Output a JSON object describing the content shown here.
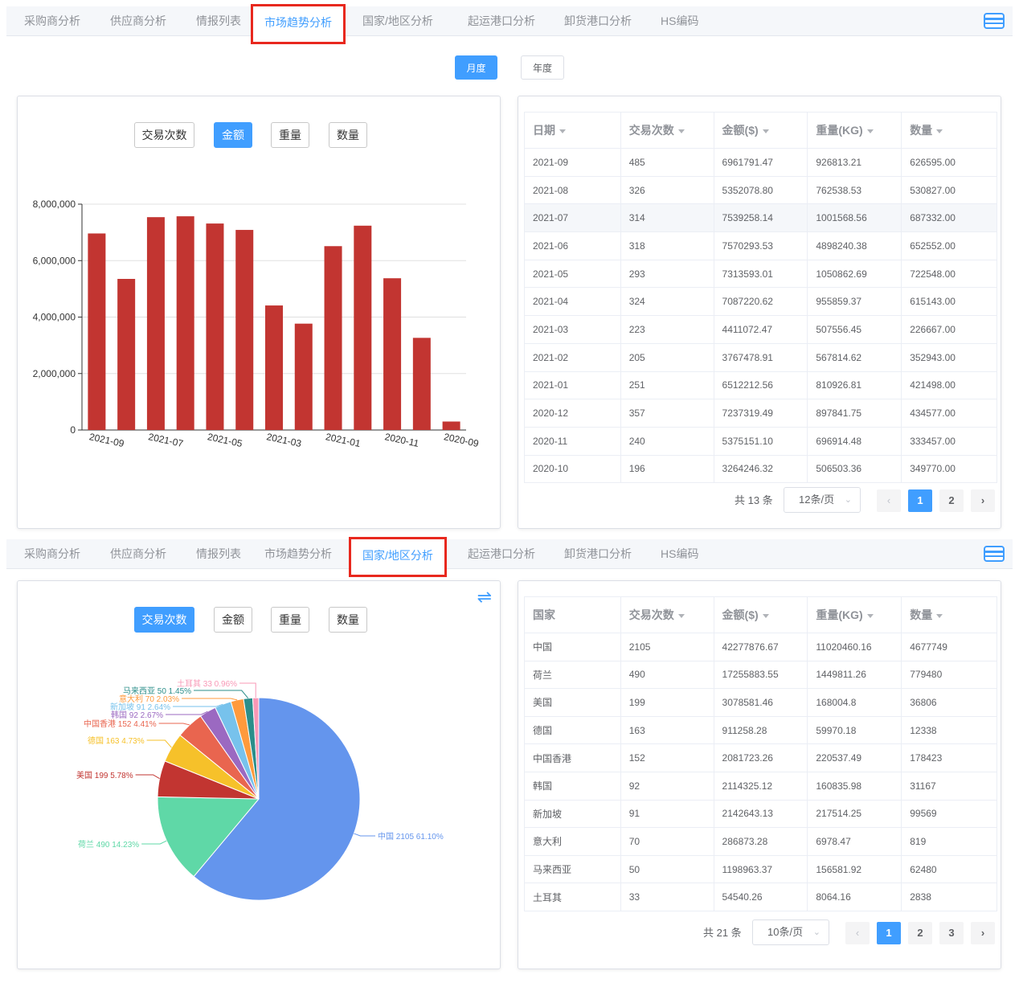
{
  "tabs": [
    "采购商分析",
    "供应商分析",
    "情报列表",
    "市场趋势分析",
    "国家/地区分析",
    "起运港口分析",
    "卸货港口分析",
    "HS编码"
  ],
  "top": {
    "active_tab_index": 3,
    "period_buttons": [
      "月度",
      "年度"
    ],
    "metric_buttons": [
      "交易次数",
      "金额",
      "重量",
      "数量"
    ],
    "active_metric_index": 1,
    "table": {
      "columns": [
        "日期",
        "交易次数",
        "金额($)",
        "重量(KG)",
        "数量"
      ],
      "rows": [
        [
          "2021-09",
          "485",
          "6961791.47",
          "926813.21",
          "626595.00"
        ],
        [
          "2021-08",
          "326",
          "5352078.80",
          "762538.53",
          "530827.00"
        ],
        [
          "2021-07",
          "314",
          "7539258.14",
          "1001568.56",
          "687332.00"
        ],
        [
          "2021-06",
          "318",
          "7570293.53",
          "4898240.38",
          "652552.00"
        ],
        [
          "2021-05",
          "293",
          "7313593.01",
          "1050862.69",
          "722548.00"
        ],
        [
          "2021-04",
          "324",
          "7087220.62",
          "955859.37",
          "615143.00"
        ],
        [
          "2021-03",
          "223",
          "4411072.47",
          "507556.45",
          "226667.00"
        ],
        [
          "2021-02",
          "205",
          "3767478.91",
          "567814.62",
          "352943.00"
        ],
        [
          "2021-01",
          "251",
          "6512212.56",
          "810926.81",
          "421498.00"
        ],
        [
          "2020-12",
          "357",
          "7237319.49",
          "897841.75",
          "434577.00"
        ],
        [
          "2020-11",
          "240",
          "5375151.10",
          "696914.48",
          "333457.00"
        ],
        [
          "2020-10",
          "196",
          "3264246.32",
          "506503.36",
          "349770.00"
        ]
      ],
      "highlight_row": 2
    },
    "pager": {
      "total": "共 13 条",
      "size": "12条/页",
      "pages": [
        "1",
        "2"
      ],
      "current": "1",
      "prev": "‹",
      "next": "›"
    }
  },
  "bottom": {
    "active_tab_index": 4,
    "metric_buttons": [
      "交易次数",
      "金额",
      "重量",
      "数量"
    ],
    "active_metric_index": 0,
    "swap_icon": "⇌",
    "table": {
      "columns": [
        "国家",
        "交易次数",
        "金额($)",
        "重量(KG)",
        "数量"
      ],
      "sortable": [
        false,
        true,
        true,
        true,
        true
      ],
      "rows": [
        [
          "中国",
          "2105",
          "42277876.67",
          "11020460.16",
          "4677749"
        ],
        [
          "荷兰",
          "490",
          "17255883.55",
          "1449811.26",
          "779480"
        ],
        [
          "美国",
          "199",
          "3078581.46",
          "168004.8",
          "36806"
        ],
        [
          "德国",
          "163",
          "911258.28",
          "59970.18",
          "12338"
        ],
        [
          "中国香港",
          "152",
          "2081723.26",
          "220537.49",
          "178423"
        ],
        [
          "韩国",
          "92",
          "2114325.12",
          "160835.98",
          "31167"
        ],
        [
          "新加坡",
          "91",
          "2142643.13",
          "217514.25",
          "99569"
        ],
        [
          "意大利",
          "70",
          "286873.28",
          "6978.47",
          "819"
        ],
        [
          "马来西亚",
          "50",
          "1198963.37",
          "156581.92",
          "62480"
        ],
        [
          "土耳其",
          "33",
          "54540.26",
          "8064.16",
          "2838"
        ]
      ]
    },
    "pager": {
      "total": "共 21 条",
      "size": "10条/页",
      "pages": [
        "1",
        "2",
        "3"
      ],
      "current": "1",
      "prev": "‹",
      "next": "›"
    }
  },
  "chart_data": [
    {
      "type": "bar",
      "categories": [
        "2021-09",
        "2021-08",
        "2021-07",
        "2021-06",
        "2021-05",
        "2021-04",
        "2021-03",
        "2021-02",
        "2021-01",
        "2020-12",
        "2020-11",
        "2020-10",
        "2020-09"
      ],
      "tick_labels": [
        "2021-09",
        "2021-07",
        "2021-05",
        "2021-03",
        "2021-01",
        "2020-11",
        "2020-09"
      ],
      "values": [
        6961791.47,
        5352078.8,
        7539258.14,
        7570293.53,
        7313593.01,
        7087220.62,
        4411072.47,
        3767478.91,
        6512212.56,
        7237319.49,
        5375151.1,
        3264246.32,
        300000
      ],
      "yticks": [
        "0",
        "2,000,000",
        "4,000,000",
        "6,000,000",
        "8,000,000"
      ],
      "ylim": [
        0,
        8000000
      ],
      "color": "#c23531",
      "grid": true
    },
    {
      "type": "pie",
      "labels": [
        "中国",
        "荷兰",
        "美国",
        "德国",
        "中国香港",
        "韩国",
        "新加坡",
        "意大利",
        "马来西亚",
        "土耳其"
      ],
      "values": [
        2105,
        490,
        199,
        163,
        152,
        92,
        91,
        70,
        50,
        33
      ],
      "percents": [
        "61.10%",
        "14.23%",
        "5.78%",
        "4.73%",
        "4.41%",
        "2.67%",
        "2.64%",
        "2.03%",
        "1.45%",
        "0.96%"
      ],
      "colors": [
        "#6495ed",
        "#5fd8a7",
        "#c23531",
        "#f6c12a",
        "#e9654f",
        "#9b69c1",
        "#77c2ec",
        "#ff9a3c",
        "#2b8e8a",
        "#f898b6"
      ]
    }
  ]
}
